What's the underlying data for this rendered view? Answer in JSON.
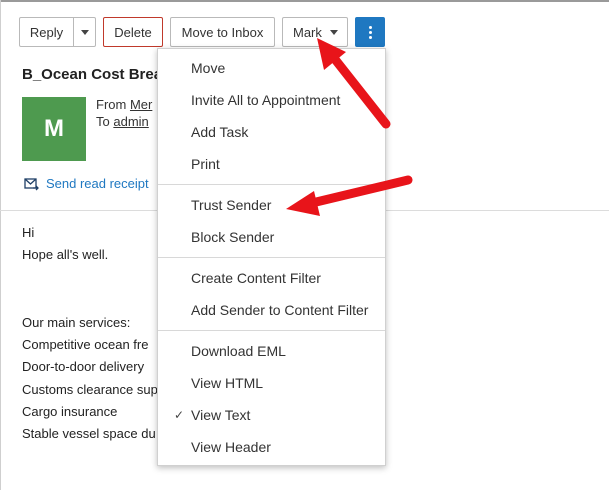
{
  "toolbar": {
    "reply": "Reply",
    "delete": "Delete",
    "move_to_inbox": "Move to Inbox",
    "mark": "Mark"
  },
  "email": {
    "subject": "B_Ocean Cost Brea",
    "avatar_letter": "M",
    "from_label": "From",
    "from_value": "Mer",
    "to_label": "To",
    "to_value": "admin",
    "send_read_receipt": "Send read receipt"
  },
  "body": {
    "lines": [
      "Hi",
      "Hope all's well.",
      "Our main services:",
      "Competitive ocean fre",
      "Door-to-door delivery",
      "Customs clearance sup",
      "Cargo insurance",
      "Stable vessel space du"
    ]
  },
  "menu": {
    "items": [
      "Move",
      "Invite All to Appointment",
      "Add Task",
      "Print",
      "Trust Sender",
      "Block Sender",
      "Create Content Filter",
      "Add Sender to Content Filter",
      "Download EML",
      "View HTML",
      "View Text",
      "View Header"
    ],
    "checked_item": "View Text",
    "check_mark": "✓"
  },
  "colors": {
    "accent": "#1f78c1",
    "avatar": "#4e9a4f",
    "delete_border": "#c0392b",
    "annotation_arrow": "#e8141a"
  }
}
